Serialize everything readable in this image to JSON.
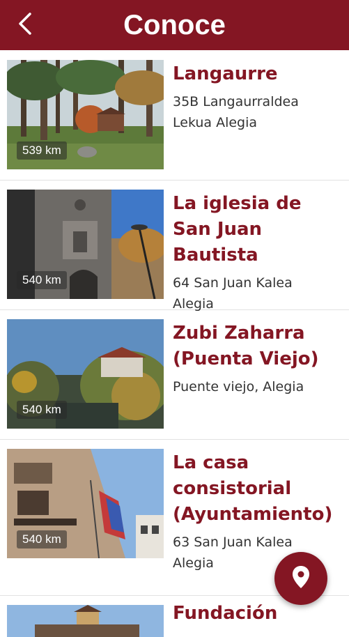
{
  "header": {
    "title": "Conoce",
    "back_icon": "chevron-left-icon"
  },
  "places": [
    {
      "name": "Langaurre",
      "address": "35B Langaurraldea\nLekua Alegia",
      "distance": "539 km"
    },
    {
      "name": "La iglesia de San Juan Bautista",
      "address": "64 San Juan Kalea\nAlegia",
      "distance": "540 km"
    },
    {
      "name": "Zubi Zaharra (Puenta Viejo)",
      "address": "Puente viejo, Alegia",
      "distance": "540 km"
    },
    {
      "name": "La casa consistorial (Ayuntamiento)",
      "address": "63 San Juan Kalea\nAlegia",
      "distance": "540 km"
    },
    {
      "name": "Fundación",
      "address": "",
      "distance": ""
    }
  ],
  "fab": {
    "icon": "map-pin-icon"
  },
  "colors": {
    "brand": "#841623",
    "divider": "#e2e2e2"
  }
}
